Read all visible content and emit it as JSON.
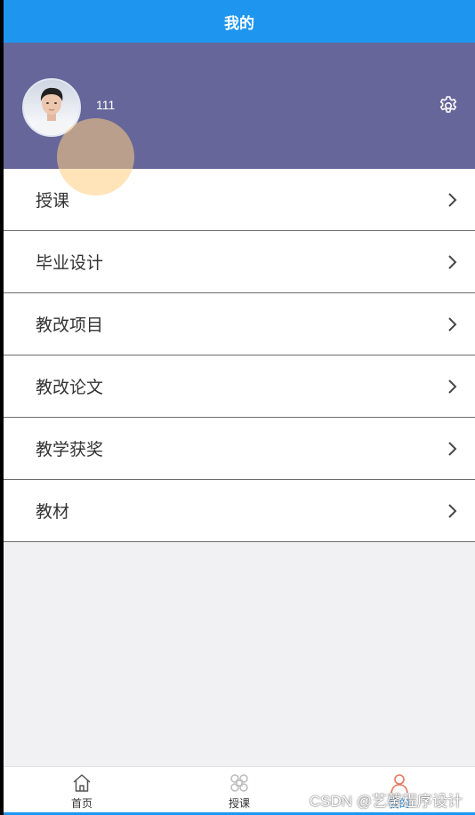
{
  "header": {
    "title": "我的"
  },
  "profile": {
    "username": "111",
    "settings_icon": "gear-icon"
  },
  "menu": {
    "items": [
      {
        "label": "授课",
        "icon": "chevron-right-icon"
      },
      {
        "label": "毕业设计",
        "icon": "chevron-right-icon"
      },
      {
        "label": "教改项目",
        "icon": "chevron-right-icon"
      },
      {
        "label": "教改论文",
        "icon": "chevron-right-icon"
      },
      {
        "label": "教学获奖",
        "icon": "chevron-right-icon"
      },
      {
        "label": "教材",
        "icon": "chevron-right-icon"
      }
    ]
  },
  "tabbar": {
    "tabs": [
      {
        "label": "首页",
        "icon": "home-icon",
        "active": false
      },
      {
        "label": "授课",
        "icon": "grid-command-icon",
        "active": false
      },
      {
        "label": "我的",
        "icon": "user-icon",
        "active": true
      }
    ]
  },
  "watermark": {
    "text": "CSDN @艺馨程序设计"
  },
  "colors": {
    "header": "#1e96f0",
    "profile_bg": "#66669a",
    "page_bg": "#f1f0f2",
    "active_tab_icon": "#e5785f",
    "active_tab_label": "#1e96f0"
  }
}
